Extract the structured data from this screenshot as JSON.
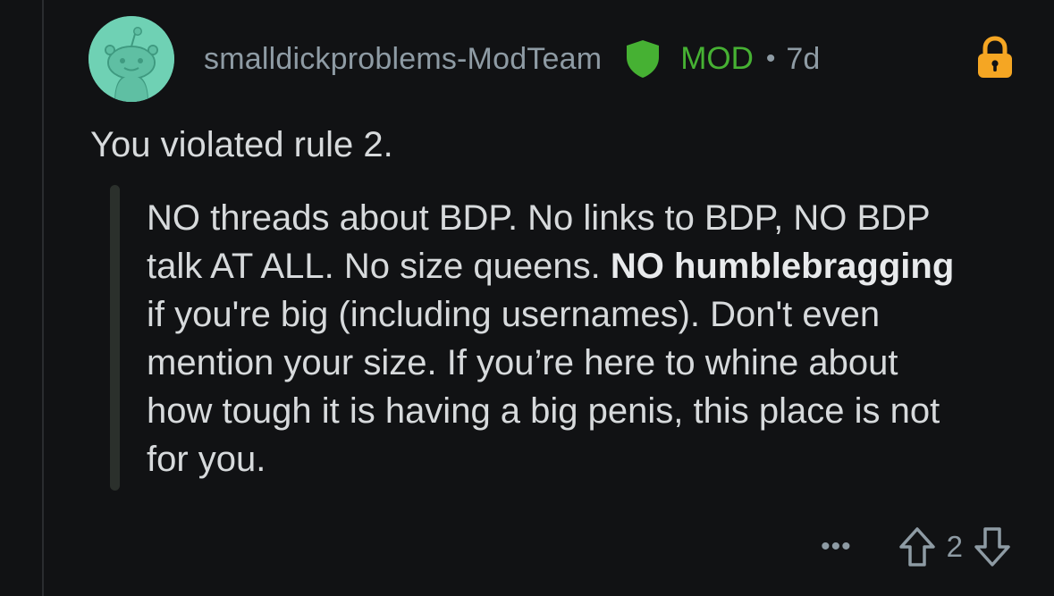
{
  "comment": {
    "author": "smalldickproblems-ModTeam",
    "badge": "MOD",
    "separator": "•",
    "age": "7d",
    "body": "You violated rule 2.",
    "quote": {
      "part1": "NO threads about BDP. No links to BDP, NO BDP talk AT ALL. No size queens. ",
      "bold": "NO humblebragging",
      "part2": " if you're big (including usernames). Don't even mention your size. If you’re here to whine about how tough it is having a big penis, this place is not for you."
    },
    "score": "2",
    "more_label": "•••"
  },
  "icons": {
    "avatar": "snoo-avatar",
    "shield": "mod-shield-icon",
    "lock": "lock-icon",
    "more": "more-options-icon",
    "upvote": "upvote-arrow-icon",
    "downvote": "downvote-arrow-icon"
  },
  "colors": {
    "background": "#111214",
    "avatar_bg": "#6fd1b4",
    "mod_green": "#46b133",
    "lock_orange": "#f5a623",
    "meta_gray": "#8e9ba4",
    "text": "#d7dadc"
  }
}
